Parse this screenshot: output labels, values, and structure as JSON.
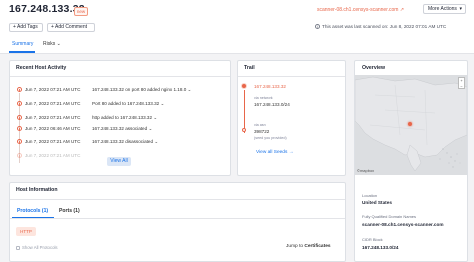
{
  "header": {
    "ip": "167.248.133.32",
    "badge": "new",
    "scanner_link": "scanner-08.ch1.censys-scanner.com ↗",
    "more_actions": "More Actions",
    "add_tags": "+ Add Tags",
    "add_comment": "+ Add Comment",
    "info": "This asset was last scanned on: Jun 8, 2022 07:01 AM UTC"
  },
  "tabs": {
    "summary": "Summary",
    "risks": "Risks"
  },
  "activity": {
    "title": "Recent Host Activity",
    "rows": [
      {
        "time": "Jun 7, 2022 07:21 AM UTC",
        "desc": "167.248.133.32 on port 80 added nginx 1.18.0"
      },
      {
        "time": "Jun 7, 2022 07:21 AM UTC",
        "desc": "Port 80 added to 167.248.133.32"
      },
      {
        "time": "Jun 7, 2022 07:21 AM UTC",
        "desc": "http added to 167.248.133.32"
      },
      {
        "time": "Jun 7, 2022 06:46 AM UTC",
        "desc": "167.248.133.32 associated"
      },
      {
        "time": "Jun 7, 2022 07:21 AM UTC",
        "desc": "167.248.133.32 disassociated"
      },
      {
        "time": "Jun 7, 2022 07:21 AM UTC",
        "desc": ""
      }
    ],
    "view_all": "View All"
  },
  "trail": {
    "title": "Trail",
    "ip": "167.248.133.32",
    "via_label": "via network",
    "network": "167.248.133.0/24",
    "via2_label": "via asn",
    "asn": "398722",
    "seed_label": "(seed you provided)",
    "view_all_seeds": "View all Seeds →"
  },
  "overview": {
    "title": "Overview",
    "zoom_in": "+",
    "zoom_out": "−",
    "location_label": "Location",
    "location": "United States",
    "fqdn_label": "Fully Qualified Domain Names",
    "fqdn": "scanner-08.ch1.censys-scanner.com",
    "cidr_label": "CIDR Block",
    "cidr": "167.248.133.0/24"
  },
  "host_info": {
    "title": "Host Information",
    "protocols_tab": "Protocols (1)",
    "ports_tab": "Ports (1)",
    "http_label": "HTTP",
    "show_all": "Show All Protocols",
    "jump_prefix": "Jump to ",
    "jump_target": "Certificates"
  },
  "colors": {
    "accent": "#e8664a",
    "link": "#1a73e8"
  }
}
